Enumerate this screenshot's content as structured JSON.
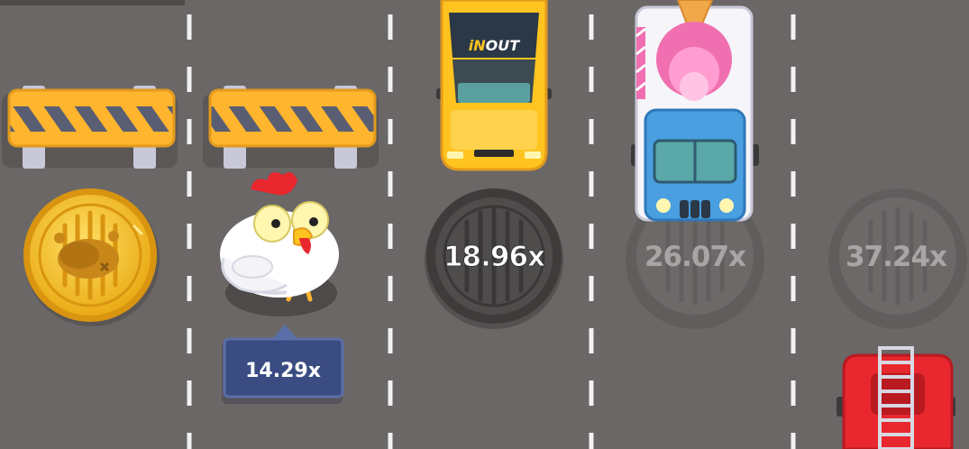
{
  "game": {
    "lanes": [
      {
        "id": "lane-1",
        "tile": "coin",
        "barrier": true,
        "coin_icon": "roast-chicken-icon"
      },
      {
        "id": "lane-2",
        "tile": "chicken",
        "barrier": true,
        "current_multiplier": "14.29x"
      },
      {
        "id": "lane-3",
        "tile": "manhole",
        "multiplier": "18.96x",
        "state": "next",
        "vehicle": "yellow-taxi"
      },
      {
        "id": "lane-4",
        "tile": "manhole",
        "multiplier": "26.07x",
        "state": "locked",
        "vehicle": "ice-cream-truck"
      },
      {
        "id": "lane-5",
        "tile": "manhole",
        "multiplier": "37.24x",
        "state": "locked",
        "vehicle": "fire-truck"
      }
    ],
    "taxi_brand": {
      "prefix": "iN",
      "suffix": "OUT"
    },
    "colors": {
      "road": "#6b6767",
      "lane_marking": "#f2f2f2",
      "coin": "#f5c320",
      "barrier_stripe": "#ffb52e",
      "taxi": "#ffc41f",
      "truck": "#4a9fe0",
      "fire_truck": "#e8272e",
      "chip": "#3a4c82"
    }
  }
}
